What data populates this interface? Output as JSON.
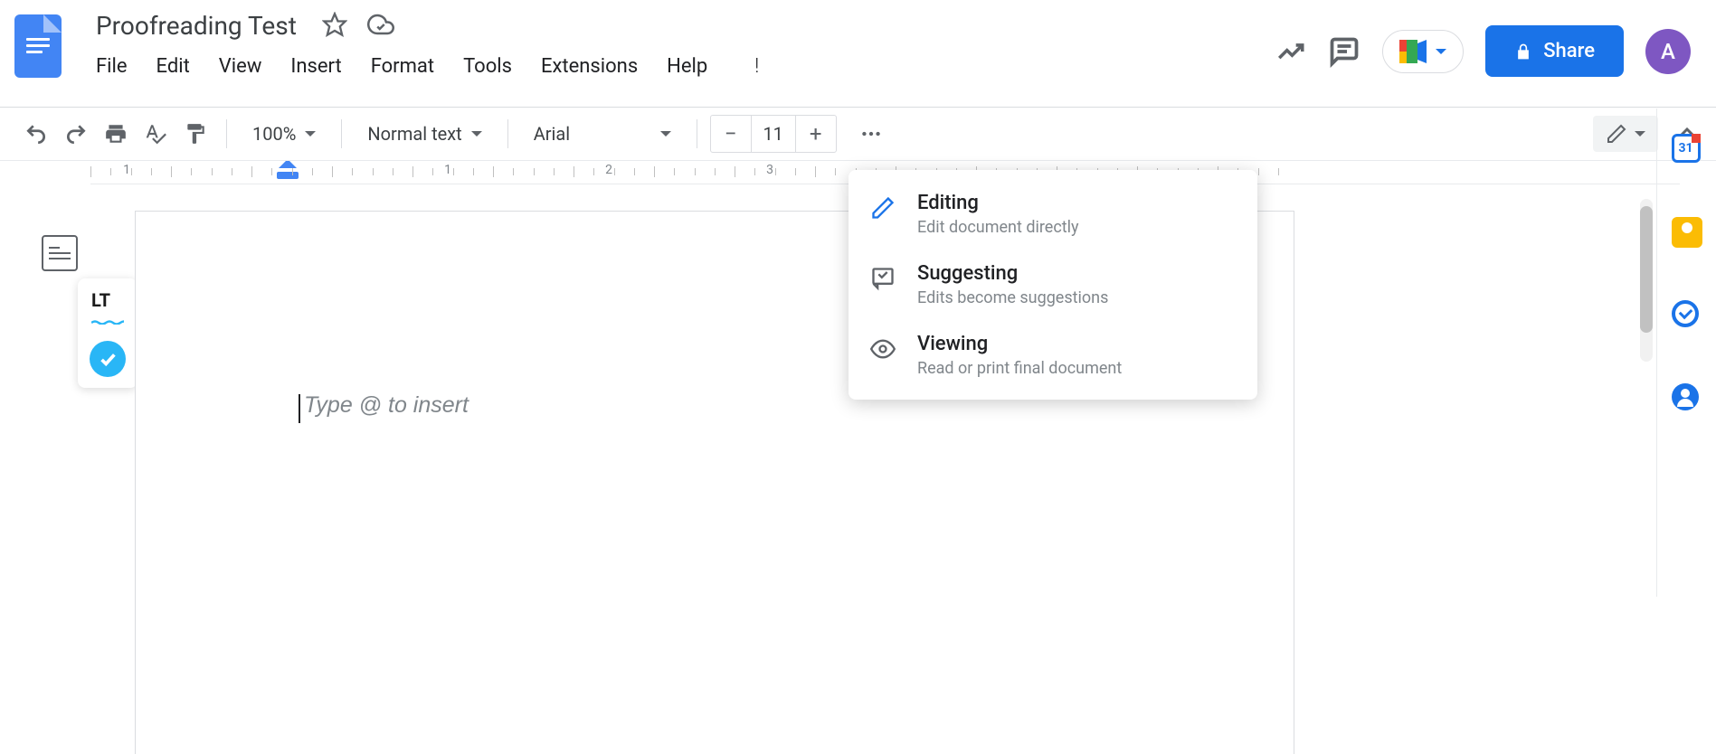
{
  "header": {
    "title": "Proofreading Test",
    "share_label": "Share",
    "avatar_initial": "A"
  },
  "menubar": {
    "items": [
      "File",
      "Edit",
      "View",
      "Insert",
      "Format",
      "Tools",
      "Extensions",
      "Help"
    ]
  },
  "toolbar": {
    "zoom": "100%",
    "style": "Normal text",
    "font": "Arial",
    "font_size": "11"
  },
  "ruler": {
    "numbers": [
      "1",
      "1",
      "2",
      "3"
    ]
  },
  "canvas": {
    "placeholder": "Type @ to insert"
  },
  "mode_menu": {
    "items": [
      {
        "title": "Editing",
        "desc": "Edit document directly",
        "icon": "pencil",
        "active": true
      },
      {
        "title": "Suggesting",
        "desc": "Edits become suggestions",
        "icon": "suggest",
        "active": false
      },
      {
        "title": "Viewing",
        "desc": "Read or print final document",
        "icon": "eye",
        "active": false
      }
    ]
  },
  "side_panel": {
    "calendar_day": "31"
  }
}
